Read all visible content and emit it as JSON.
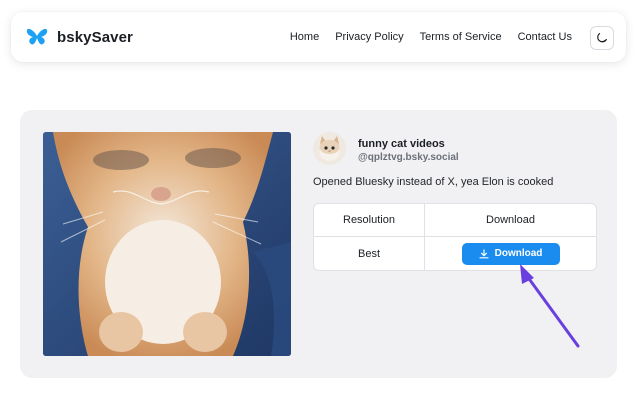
{
  "brand": {
    "name": "bskySaver",
    "logo_icon": "butterfly-icon",
    "color": "#1da1f2"
  },
  "nav": {
    "links": [
      "Home",
      "Privacy Policy",
      "Terms of Service",
      "Contact Us"
    ],
    "theme_toggle_icon": "moon-icon"
  },
  "post": {
    "author_name": "funny cat videos",
    "author_handle": "@qplztvg.bsky.social",
    "text": "Opened Bluesky instead of X, yea Elon is cooked"
  },
  "table": {
    "headers": [
      "Resolution",
      "Download"
    ],
    "rows": [
      {
        "resolution": "Best",
        "button_label": "Download",
        "button_icon": "download-icon"
      }
    ]
  },
  "colors": {
    "accent": "#1a8cef",
    "annotation_arrow": "#6a3fe0",
    "card_bg": "#f1f1f3"
  }
}
